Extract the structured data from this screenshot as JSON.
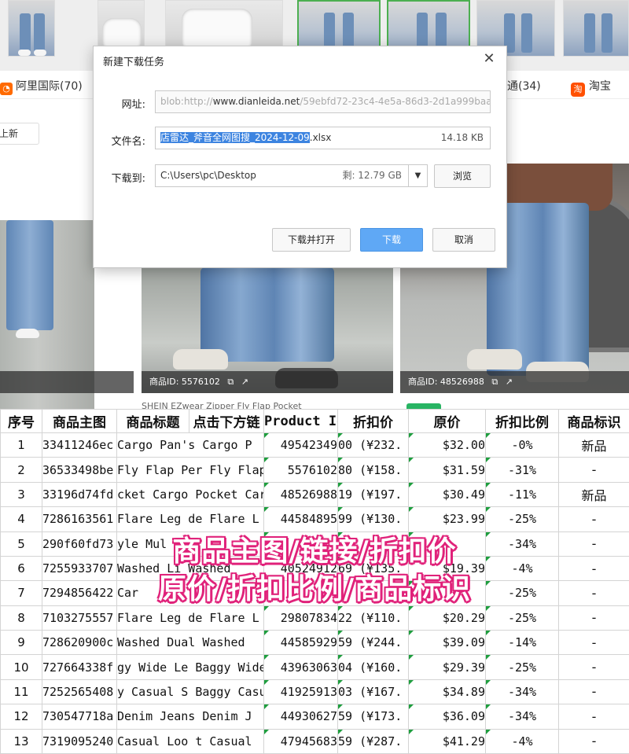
{
  "source_tabs": {
    "alibaba": "阿里国际(70)",
    "other": "通(34)",
    "taobao": "淘宝"
  },
  "filter_button": "上新",
  "cards": [
    {
      "id_label": "商品ID: 5576102"
    },
    {
      "id_label": "商品ID: 48526988"
    }
  ],
  "card_title_snippet": "SHEIN EZwear Zipper Fly Flap Pocket",
  "dialog": {
    "title": "新建下载任务",
    "url_label": "网址:",
    "url_prefix": "blob:http://",
    "url_domain": "www.dianleida.net",
    "url_rest": "/59ebfd72-23c4-4e5a-86d3-2d1a999baa",
    "filename_label": "文件名:",
    "filename_selected": "店雷达_斧音全网图搜_2024-12-09",
    "filename_ext": ".xlsx",
    "filesize": "14.18 KB",
    "saveto_label": "下载到:",
    "path": "C:\\Users\\pc\\Desktop",
    "free_space": "剩: 12.79 GB",
    "browse": "浏览",
    "download_open": "下载并打开",
    "download": "下载",
    "cancel": "取消"
  },
  "sheet": {
    "headers": [
      "序号",
      "商品主图",
      "商品标题",
      "点击下方链",
      "Product Id",
      "折扣价",
      "原价",
      "折扣比例",
      "商品标识"
    ],
    "rows": [
      [
        "1",
        "33411246ec",
        "Cargo Pan's Cargo P",
        "49542349",
        "00 (¥232.",
        "$32.00",
        "-0%",
        "新品"
      ],
      [
        "2",
        "36533498be",
        "Fly Flap Per Fly Flap",
        "5576102",
        "80 (¥158.",
        "$31.59",
        "-31%",
        "-"
      ],
      [
        "3",
        "33196d74fd",
        "cket Cargo Pocket Car",
        "48526988",
        "19 (¥197.",
        "$30.49",
        "-11%",
        "新品"
      ],
      [
        "4",
        "7286163561",
        "Flare Leg de Flare L",
        "44584895",
        "99 (¥130.",
        "$23.99",
        "-25%",
        "-"
      ],
      [
        "5",
        "290f60fd73",
        "yle Mul",
        "",
        "",
        "",
        "-34%",
        "-"
      ],
      [
        "6",
        "7255933707",
        "Washed Li Washed",
        "40524912",
        "69 (¥135.",
        "$19.39",
        "-4%",
        "-"
      ],
      [
        "7",
        "7294856422",
        "Car",
        "",
        "",
        "",
        "-25%",
        "-"
      ],
      [
        "8",
        "7103275557",
        "Flare Leg de Flare L",
        "29807834",
        "22 (¥110.",
        "$20.29",
        "-25%",
        "-"
      ],
      [
        "9",
        "728620900c",
        "Washed Dual Washed",
        "44585929",
        "59 (¥244.",
        "$39.09",
        "-14%",
        "-"
      ],
      [
        "10",
        "727664338f",
        "gy Wide Le Baggy Wide",
        "43963063",
        "04 (¥160.",
        "$29.39",
        "-25%",
        "-"
      ],
      [
        "11",
        "7252565408",
        "y Casual S Baggy Casua",
        "41925913",
        "03 (¥167.",
        "$34.89",
        "-34%",
        "-"
      ],
      [
        "12",
        "730547718a",
        "Denim Jeans Denim J",
        "44930627",
        "59 (¥173.",
        "$36.09",
        "-34%",
        "-"
      ],
      [
        "13",
        "7319095240",
        "Casual Loo t Casual",
        "47945683",
        "59 (¥287.",
        "$41.29",
        "-4%",
        "-"
      ]
    ]
  },
  "caption": {
    "line1": "商品主图/链接/折扣价",
    "line2": "原价/折扣比例/商品标识"
  },
  "colors": {
    "primary_button": "#5fa8f5",
    "caption_outline": "#e0227a",
    "selection": "#3d84e0",
    "new_tag": "#28b463"
  }
}
